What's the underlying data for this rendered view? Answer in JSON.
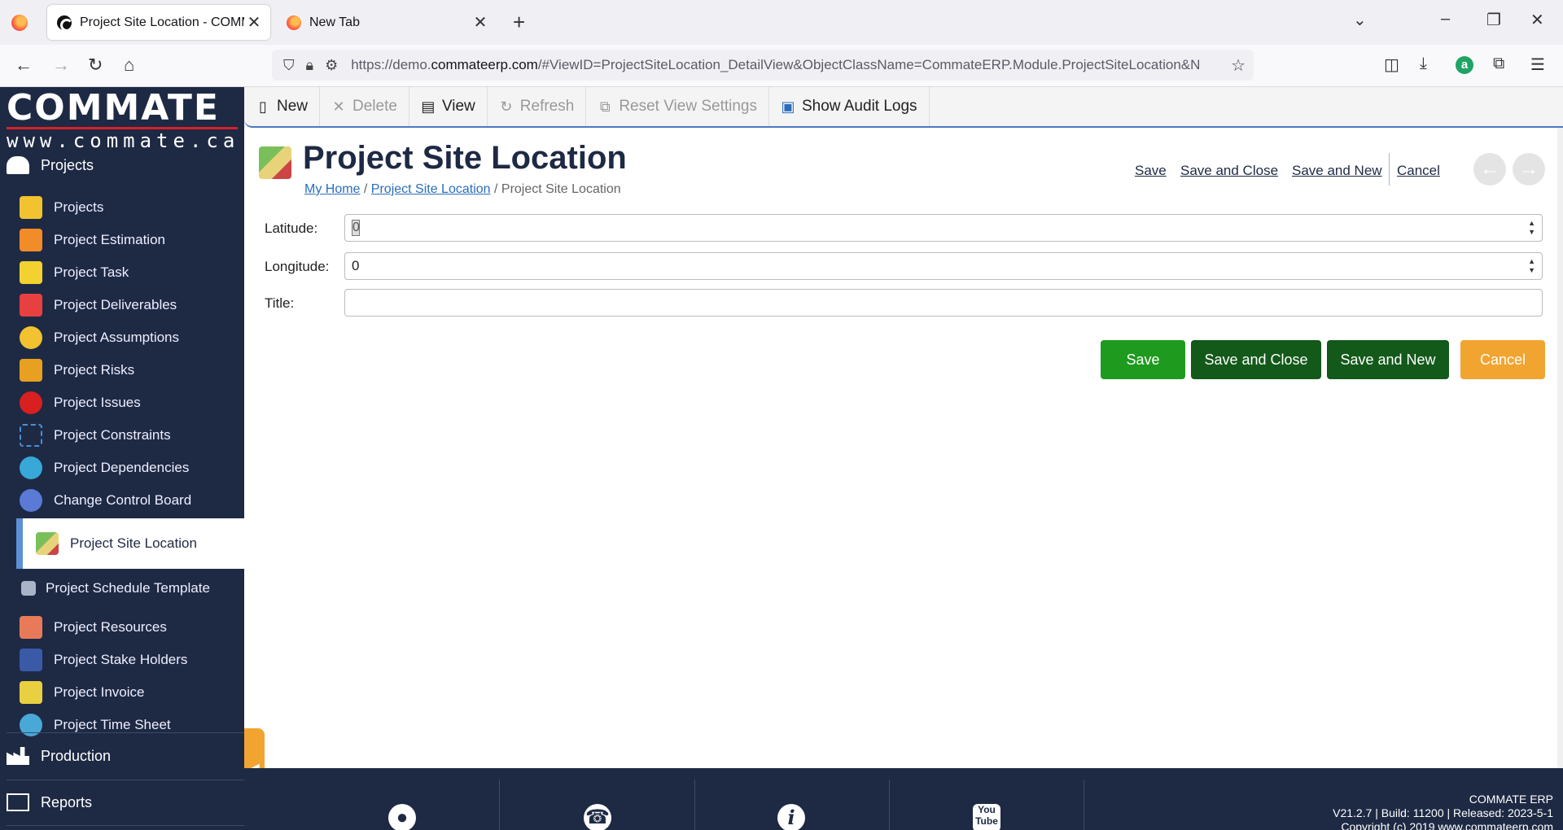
{
  "browser": {
    "tabs": [
      {
        "title": "Project Site Location - COMMATE ERP",
        "active": true
      },
      {
        "title": "New Tab",
        "active": false
      }
    ],
    "url_prefix": "https://demo.",
    "url_domain": "commateerp.com",
    "url_rest": "/#ViewID=ProjectSiteLocation_DetailView&ObjectClassName=CommateERP.Module.ProjectSiteLocation&N"
  },
  "brand": {
    "name": "COMMATE",
    "site": "www.commate.ca"
  },
  "sidebar": {
    "group_projects": "Projects",
    "items": [
      {
        "label": "Projects",
        "color": "#f2c230"
      },
      {
        "label": "Project Estimation",
        "color": "#f28c28"
      },
      {
        "label": "Project Task",
        "color": "#f2d230"
      },
      {
        "label": "Project Deliverables",
        "color": "#e84040"
      },
      {
        "label": "Project Assumptions",
        "color": "#f2c230"
      },
      {
        "label": "Project Risks",
        "color": "#e8a020"
      },
      {
        "label": "Project Issues",
        "color": "#d82020"
      },
      {
        "label": "Project Constraints",
        "color": "#4a90d6"
      },
      {
        "label": "Project Dependencies",
        "color": "#38a8d8"
      },
      {
        "label": "Change Control Board",
        "color": "#5a7ad6"
      },
      {
        "label": "Project Site Location",
        "color": "#7bbf5a"
      },
      {
        "label": "Project Schedule Template",
        "color": "#aab4c8"
      },
      {
        "label": "Project Resources",
        "color": "#e87a5a"
      },
      {
        "label": "Project Stake Holders",
        "color": "#3a5aa8"
      },
      {
        "label": "Project Invoice",
        "color": "#e8d040"
      },
      {
        "label": "Project Time Sheet",
        "color": "#4aa8d8"
      }
    ],
    "group_production": "Production",
    "group_reports": "Reports"
  },
  "toolbar": {
    "new": "New",
    "delete": "Delete",
    "view": "View",
    "refresh": "Refresh",
    "reset": "Reset View Settings",
    "audit": "Show Audit Logs"
  },
  "page": {
    "title": "Project Site Location",
    "breadcrumb": {
      "home": "My Home",
      "list": "Project Site Location",
      "current": "Project Site Location"
    },
    "header_links": {
      "save": "Save",
      "save_close": "Save and Close",
      "save_new": "Save and New",
      "cancel": "Cancel"
    }
  },
  "form": {
    "latitude_label": "Latitude:",
    "latitude_value": "0",
    "longitude_label": "Longitude:",
    "longitude_value": "0",
    "title_label": "Title:",
    "title_value": ""
  },
  "buttons": {
    "save": "Save",
    "save_close": "Save and Close",
    "save_new": "Save and New",
    "cancel": "Cancel",
    "colors": {
      "save": "#1e9a1e",
      "save_close": "#13591a",
      "save_new": "#13591a",
      "cancel": "#f2a430"
    }
  },
  "footer": {
    "product": "COMMATE ERP",
    "version": "V21.2.7 | Build: 11200 | Released: 2023-5-1",
    "copyright": "Copyright (c) 2019 www.commateerp.com"
  }
}
